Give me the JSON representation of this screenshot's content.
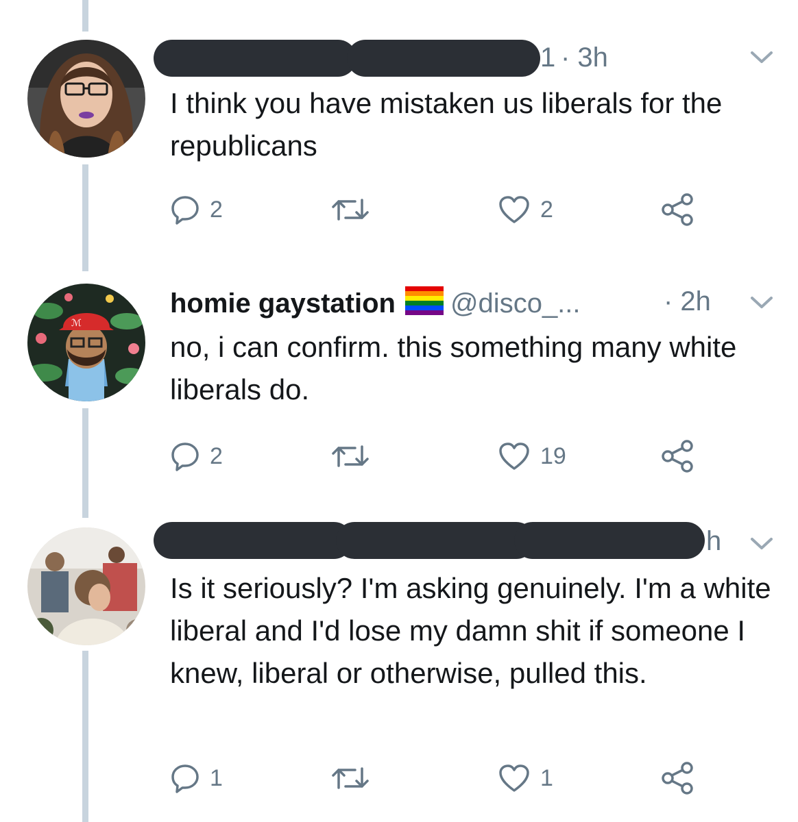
{
  "tweets": [
    {
      "author_visible_suffix": "1",
      "time": "· 3h",
      "text": "I think you have mistaken us liberals for the republicans",
      "replies": "2",
      "likes": "2"
    },
    {
      "name": "homie gaystation",
      "handle": "@disco_...",
      "time": "· 2h",
      "text": "no, i can confirm. this something many white liberals do.",
      "replies": "2",
      "likes": "19"
    },
    {
      "time": "h",
      "text": "Is it seriously? I'm asking genuinely. I'm a white liberal and I'd lose my damn shit if someone I knew, liberal or otherwise, pulled this.",
      "replies": "1",
      "likes": "1"
    }
  ],
  "icons": {
    "reply": "reply-icon",
    "retweet": "retweet-icon",
    "like": "heart-icon",
    "share": "share-icon",
    "more": "chevron-down-icon",
    "flag": "rainbow-flag-icon"
  },
  "colors": {
    "thread_line": "#c8d4de",
    "secondary_text": "#657786",
    "redaction": "#2b2f35"
  }
}
